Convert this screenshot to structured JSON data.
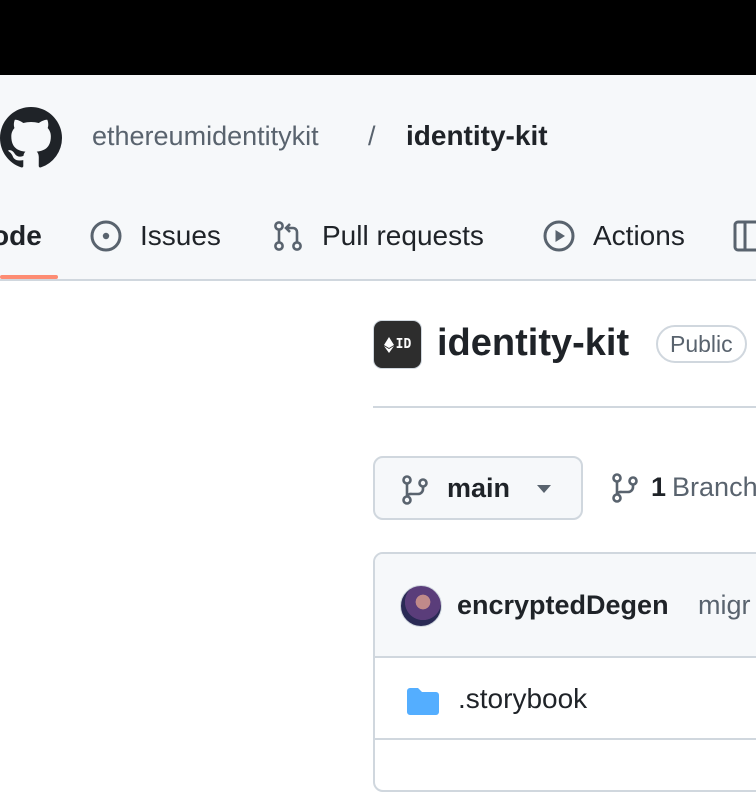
{
  "repo_header": {
    "owner": "ethereumidentitykit",
    "separator": "/",
    "repo": "identity-kit"
  },
  "tabs": [
    {
      "label": "Code",
      "visible_text": "ode",
      "icon": "code-icon",
      "selected": true
    },
    {
      "label": "Issues",
      "icon": "issue-opened-icon"
    },
    {
      "label": "Pull requests",
      "icon": "git-pull-request-icon"
    },
    {
      "label": "Actions",
      "icon": "play-icon"
    },
    {
      "label": "",
      "icon": "table-icon"
    }
  ],
  "repo": {
    "avatar_text": "ID",
    "title": "identity-kit",
    "visibility": "Public"
  },
  "branch": {
    "current": "main",
    "branches_count": "1",
    "branches_label": "Branch"
  },
  "latest_commit": {
    "author": "encryptedDegen",
    "message": "migr"
  },
  "files": [
    {
      "name": ".storybook",
      "icon": "folder-icon"
    }
  ],
  "colors": {
    "header_bg": "#f6f8fa",
    "border": "#d0d7de",
    "selected_tab_underline": "#fd8c73",
    "folder": "#54aeff",
    "muted_text": "#59636e",
    "text": "#1f2328"
  }
}
